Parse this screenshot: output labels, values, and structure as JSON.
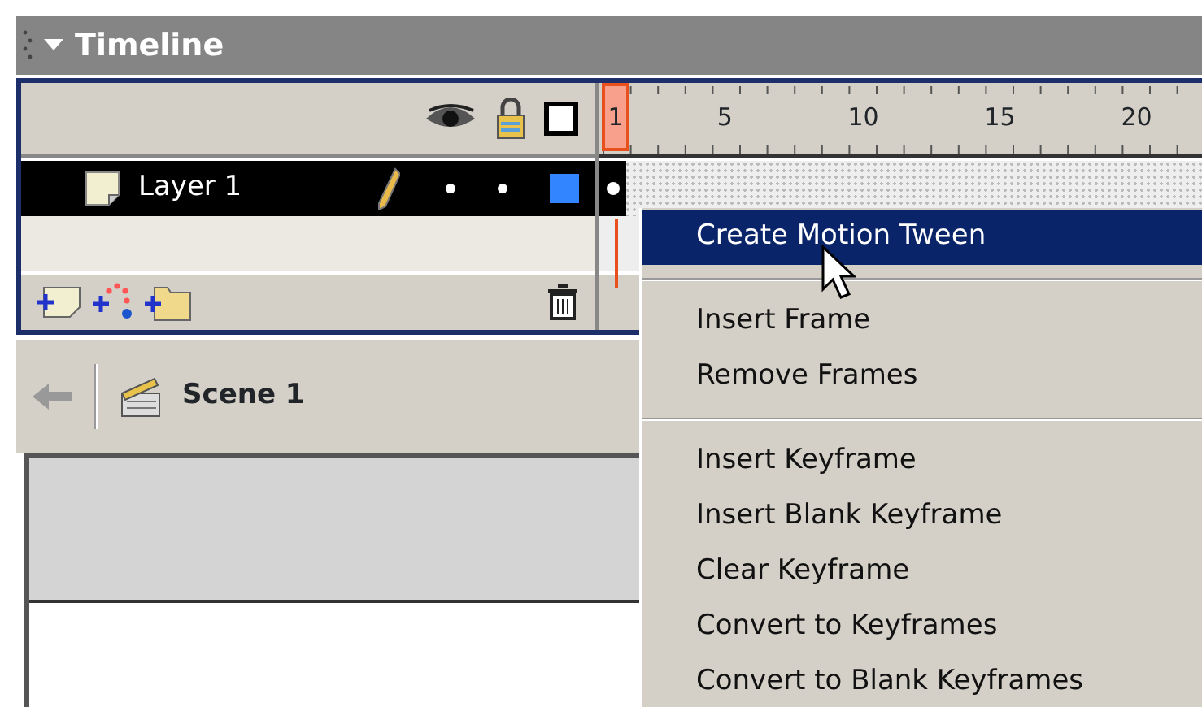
{
  "panel": {
    "title": "Timeline",
    "expanded": true
  },
  "layers": [
    {
      "name": "Layer 1",
      "selected": true,
      "color": "#3385ff"
    }
  ],
  "ruler": {
    "labels": [
      {
        "label": "1",
        "selected": true
      },
      {
        "label": "5",
        "selected": false
      },
      {
        "label": "10",
        "selected": false
      },
      {
        "label": "15",
        "selected": false
      },
      {
        "label": "20",
        "selected": false
      }
    ]
  },
  "scene": {
    "name": "Scene 1"
  },
  "context_menu": {
    "items": [
      {
        "kind": "item",
        "label": "Create Motion Tween",
        "selected": true
      },
      {
        "kind": "separator"
      },
      {
        "kind": "item",
        "label": "Insert Frame",
        "selected": false
      },
      {
        "kind": "item",
        "label": "Remove Frames",
        "selected": false
      },
      {
        "kind": "separator"
      },
      {
        "kind": "item",
        "label": "Insert Keyframe",
        "selected": false
      },
      {
        "kind": "item",
        "label": "Insert Blank Keyframe",
        "selected": false
      },
      {
        "kind": "item",
        "label": "Clear Keyframe",
        "selected": false
      },
      {
        "kind": "item",
        "label": "Convert to Keyframes",
        "selected": false
      },
      {
        "kind": "item",
        "label": "Convert to Blank Keyframes",
        "selected": false
      }
    ]
  }
}
